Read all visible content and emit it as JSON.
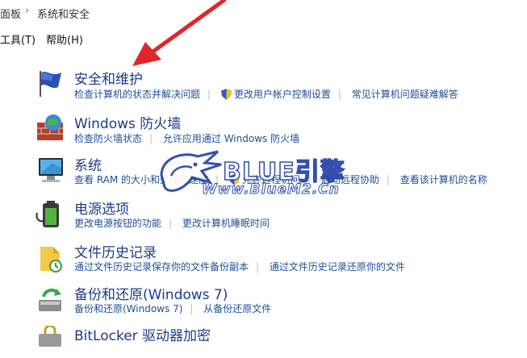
{
  "address": {
    "prev": "面板",
    "current": "系统和安全"
  },
  "menu": [
    "工具(T)",
    "帮助(H)"
  ],
  "items": [
    {
      "title": "安全和维护",
      "icon": "flag-icon",
      "links": [
        "检查计算机的状态并解决问题",
        "更改用户帐户控制设置",
        "常见计算机问题疑难解答"
      ]
    },
    {
      "title": "Windows 防火墙",
      "icon": "firewall-icon",
      "links": [
        "检查防火墙状态",
        "允许应用通过 Windows 防火墙"
      ]
    },
    {
      "title": "系统",
      "icon": "monitor-icon",
      "links": [
        "查看 RAM 的大小和处理器速度",
        "允许远程访问",
        "启动远程协助",
        "查看该计算机的名称"
      ]
    },
    {
      "title": "电源选项",
      "icon": "battery-icon",
      "links": [
        "更改电源按钮的功能",
        "更改计算机睡眠时间"
      ]
    },
    {
      "title": "文件历史记录",
      "icon": "file-history-icon",
      "links": [
        "通过文件历史记录保存你的文件备份副本",
        "通过文件历史记录还原你的文件"
      ]
    },
    {
      "title": "备份和还原(Windows 7)",
      "icon": "backup-icon",
      "links": [
        "备份和还原(Windows 7)",
        "从备份还原文件"
      ]
    },
    {
      "title": "BitLocker 驱动器加密",
      "icon": "bitlocker-icon",
      "links": []
    }
  ],
  "watermark": {
    "title": "BLUE引擎",
    "url": "Www.BlueM2.Cn"
  },
  "colors": {
    "link": "#1f4e9a",
    "title": "#1e3a8a",
    "arrow": "#e0262a"
  }
}
